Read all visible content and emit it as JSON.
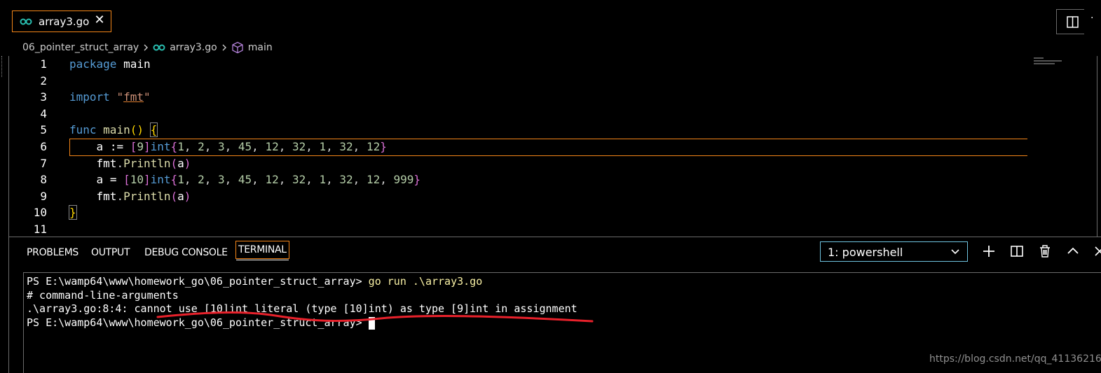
{
  "tab": {
    "label": "array3.go",
    "close": "✕"
  },
  "breadcrumb": {
    "folder": "06_pointer_struct_array",
    "file": "array3.go",
    "symbol": "main"
  },
  "editor": {
    "lines": [
      {
        "n": "1"
      },
      {
        "n": "2"
      },
      {
        "n": "3"
      },
      {
        "n": "4"
      },
      {
        "n": "5"
      },
      {
        "n": "6"
      },
      {
        "n": "7"
      },
      {
        "n": "8"
      },
      {
        "n": "9"
      },
      {
        "n": "10"
      },
      {
        "n": "11"
      }
    ]
  },
  "panel": {
    "tabs": [
      "PROBLEMS",
      "OUTPUT",
      "DEBUG CONSOLE",
      "TERMINAL"
    ],
    "active_tab": "TERMINAL",
    "terminal_select": "1: powershell",
    "terminal": {
      "line1_prompt": "PS E:\\wamp64\\www\\homework_go\\06_pointer_struct_array> ",
      "line1_cmd": "go run .\\array3.go",
      "line2": "# command-line-arguments",
      "line3": ".\\array3.go:8:4: cannot use [10]int literal (type [10]int) as type [9]int in assignment",
      "line4_prompt": "PS E:\\wamp64\\www\\homework_go\\06_pointer_struct_array> "
    }
  },
  "watermark": "https://blog.csdn.net/qq_41136216",
  "colors": {
    "accent_border": "#f38518",
    "keyword": "#569cd6",
    "function": "#dcdcaa",
    "string": "#ce9178",
    "number": "#b5cea8",
    "highlight_line": "#e8212b"
  }
}
